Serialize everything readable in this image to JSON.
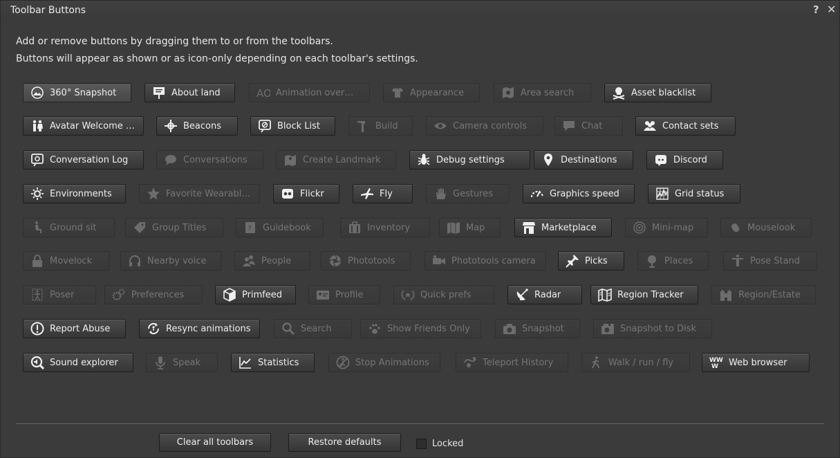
{
  "window": {
    "title": "Toolbar Buttons",
    "help": "?",
    "close": "✕"
  },
  "instructions": [
    "Add or remove buttons by dragging them to or from the toolbars.",
    "Buttons will appear as shown or as icon-only depending on each toolbar's settings."
  ],
  "rows": [
    [
      {
        "label": "360° Snapshot",
        "icon": "panorama-icon",
        "enabled": true,
        "pressed": true
      },
      {
        "label": "About land",
        "icon": "sign-icon",
        "enabled": true
      },
      {
        "label": "Animation over…",
        "icon": "ao-icon",
        "enabled": false
      },
      {
        "label": "Appearance",
        "icon": "shirt-icon",
        "enabled": false
      },
      {
        "label": "Area search",
        "icon": "map-search-icon",
        "enabled": false
      },
      {
        "label": "Asset blacklist",
        "icon": "skull-icon",
        "enabled": true
      }
    ],
    [
      {
        "label": "Avatar Welcome …",
        "icon": "avatars-icon",
        "enabled": true
      },
      {
        "label": "Beacons",
        "icon": "beacon-icon",
        "enabled": true
      },
      {
        "label": "Block List",
        "icon": "block-list-icon",
        "enabled": true
      },
      {
        "label": "Build",
        "icon": "hammer-icon",
        "enabled": false
      },
      {
        "label": "Camera controls",
        "icon": "eye-icon",
        "enabled": false
      },
      {
        "label": "Chat",
        "icon": "chat-bubble-icon",
        "enabled": false
      },
      {
        "label": "Contact sets",
        "icon": "contacts-icon",
        "enabled": true
      }
    ],
    [
      {
        "label": "Conversation Log",
        "icon": "conversation-log-icon",
        "enabled": true
      },
      {
        "label": "Conversations",
        "icon": "speech-icon",
        "enabled": false
      },
      {
        "label": "Create Landmark",
        "icon": "landmark-icon",
        "enabled": false
      },
      {
        "label": "Debug settings",
        "icon": "bug-icon",
        "enabled": true
      },
      {
        "label": "Destinations",
        "icon": "map-pin-icon",
        "enabled": true
      },
      {
        "label": "Discord",
        "icon": "discord-icon",
        "enabled": true
      }
    ],
    [
      {
        "label": "Environments",
        "icon": "sun-icon",
        "enabled": true
      },
      {
        "label": "Favorite Wearabl…",
        "icon": "star-icon",
        "enabled": false
      },
      {
        "label": "Flickr",
        "icon": "flickr-icon",
        "enabled": true
      },
      {
        "label": "Fly",
        "icon": "fly-icon",
        "enabled": true
      },
      {
        "label": "Gestures",
        "icon": "hand-icon",
        "enabled": false
      },
      {
        "label": "Graphics speed",
        "icon": "speedometer-icon",
        "enabled": true
      },
      {
        "label": "Grid status",
        "icon": "grid-status-icon",
        "enabled": true
      }
    ],
    [
      {
        "label": "Ground sit",
        "icon": "sit-icon",
        "enabled": false
      },
      {
        "label": "Group Titles",
        "icon": "tag-icon",
        "enabled": false
      },
      {
        "label": "Guidebook",
        "icon": "guidebook-icon",
        "enabled": false
      },
      {
        "label": "Inventory",
        "icon": "suitcase-icon",
        "enabled": false
      },
      {
        "label": "Map",
        "icon": "map-icon",
        "enabled": false
      },
      {
        "label": "Marketplace",
        "icon": "store-icon",
        "enabled": true
      },
      {
        "label": "Mini-map",
        "icon": "radar-circle-icon",
        "enabled": false
      },
      {
        "label": "Mouselook",
        "icon": "mouse-icon",
        "enabled": false
      }
    ],
    [
      {
        "label": "Movelock",
        "icon": "lock-icon",
        "enabled": false
      },
      {
        "label": "Nearby voice",
        "icon": "headphones-icon",
        "enabled": false
      },
      {
        "label": "People",
        "icon": "people-icon",
        "enabled": false
      },
      {
        "label": "Phototools",
        "icon": "aperture-icon",
        "enabled": false
      },
      {
        "label": "Phototools camera",
        "icon": "video-camera-icon",
        "enabled": false
      },
      {
        "label": "Picks",
        "icon": "pushpin-icon",
        "enabled": true
      },
      {
        "label": "Places",
        "icon": "globe-pin-icon",
        "enabled": false
      },
      {
        "label": "Pose Stand",
        "icon": "pose-stand-icon",
        "enabled": false
      }
    ],
    [
      {
        "label": "Poser",
        "icon": "poser-icon",
        "enabled": false
      },
      {
        "label": "Preferences",
        "icon": "gears-icon",
        "enabled": false
      },
      {
        "label": "Primfeed",
        "icon": "cube-icon",
        "enabled": true
      },
      {
        "label": "Profile",
        "icon": "id-card-icon",
        "enabled": false
      },
      {
        "label": "Quick prefs",
        "icon": "wreath-icon",
        "enabled": false
      },
      {
        "label": "Radar",
        "icon": "satellite-dish-icon",
        "enabled": true
      },
      {
        "label": "Region Tracker",
        "icon": "region-tracker-icon",
        "enabled": true
      },
      {
        "label": "Region/Estate",
        "icon": "castle-icon",
        "enabled": false
      }
    ],
    [
      {
        "label": "Report Abuse",
        "icon": "exclamation-icon",
        "enabled": true
      },
      {
        "label": "Resync animations",
        "icon": "resync-icon",
        "enabled": true
      },
      {
        "label": "Search",
        "icon": "search-icon",
        "enabled": false
      },
      {
        "label": "Show Friends Only",
        "icon": "paw-icon",
        "enabled": false
      },
      {
        "label": "Snapshot",
        "icon": "camera-icon",
        "enabled": false
      },
      {
        "label": "Snapshot to Disk",
        "icon": "camera-disk-icon",
        "enabled": false
      }
    ],
    [
      {
        "label": "Sound explorer",
        "icon": "sound-search-icon",
        "enabled": true
      },
      {
        "label": "Speak",
        "icon": "microphone-icon",
        "enabled": false
      },
      {
        "label": "Statistics",
        "icon": "line-chart-icon",
        "enabled": true
      },
      {
        "label": "Stop Animations",
        "icon": "stop-anim-icon",
        "enabled": false
      },
      {
        "label": "Teleport History",
        "icon": "teleport-history-icon",
        "enabled": false
      },
      {
        "label": "Walk / run / fly",
        "icon": "walk-icon",
        "enabled": false
      },
      {
        "label": "Web browser",
        "icon": "www-icon",
        "enabled": true
      }
    ]
  ],
  "footer": {
    "clear_label": "Clear all toolbars",
    "restore_label": "Restore defaults",
    "locked_label": "Locked",
    "locked_checked": false
  }
}
